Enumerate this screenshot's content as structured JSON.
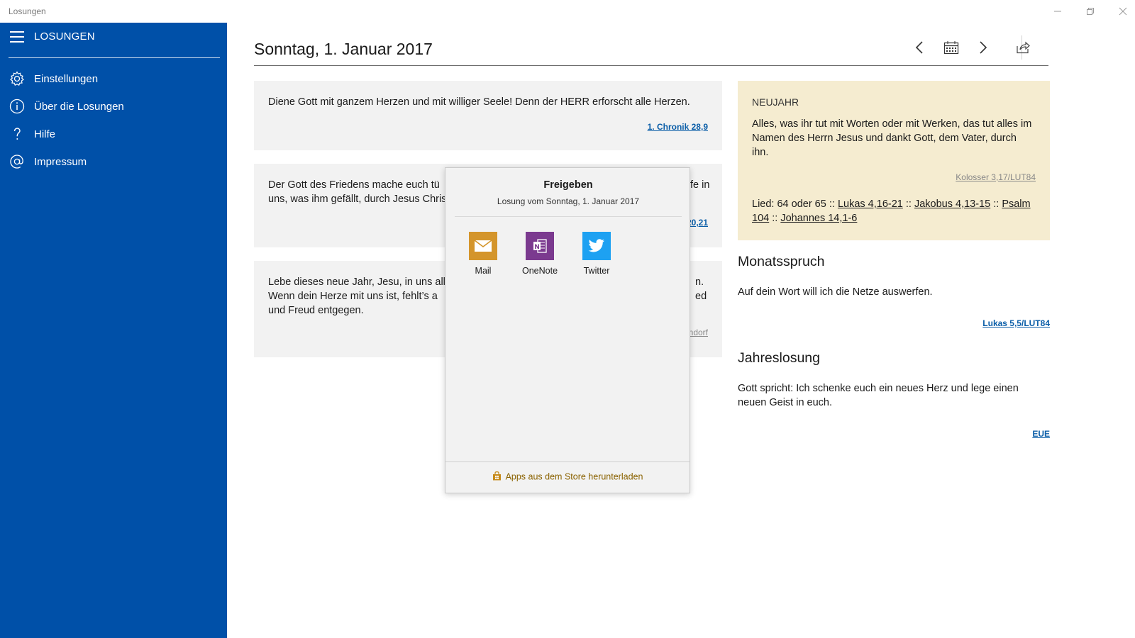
{
  "window": {
    "title": "Losungen"
  },
  "sidebar": {
    "title": "LOSUNGEN",
    "items": [
      {
        "label": "Einstellungen",
        "icon": "gear-icon"
      },
      {
        "label": "Über die Losungen",
        "icon": "info-icon"
      },
      {
        "label": "Hilfe",
        "icon": "help-icon"
      },
      {
        "label": "Impressum",
        "icon": "at-icon"
      }
    ]
  },
  "header": {
    "date": "Sonntag, 1. Januar 2017"
  },
  "cards": [
    {
      "text": "Diene Gott mit ganzem Herzen und mit williger Seele! Denn der HERR erforscht alle Herzen.",
      "ref": "1. Chronik 28,9"
    },
    {
      "text_left": "Der Gott des Friedens mache euch tü",
      "text_right": "fe in",
      "text2_left": "uns, was ihm gefällt, durch Jesus Chris",
      "ref": "20,21"
    },
    {
      "line1_left": "Lebe dieses neue Jahr, Jesu, in uns all",
      "line1_right": "n.",
      "line2_left": "Wenn dein Herze mit uns ist, fehlt’s a",
      "line2_right": "ed",
      "line3": "und Freud entgegen.",
      "ref": "ndorf"
    }
  ],
  "panel": {
    "heading": "NEUJAHR",
    "text": "Alles, was ihr tut mit Worten oder mit Werken, das tut alles im Namen des Herrn Jesus und dankt Gott, dem Vater, durch ihn.",
    "ref": "Kolosser 3,17/LUT84",
    "lied_prefix": "Lied: 64 oder 65 ::",
    "links": [
      "Lukas 4,16-21",
      "Jakobus 4,13-15",
      "Psalm 104",
      "Johannes 14,1-6"
    ],
    "separator": "::"
  },
  "monatsspruch": {
    "title": "Monatsspruch",
    "text": "Auf dein Wort will ich die Netze auswerfen.",
    "ref": "Lukas 5,5/LUT84"
  },
  "jahreslosung": {
    "title": "Jahreslosung",
    "text": "Gott spricht: Ich schenke euch ein neues Herz und lege einen neuen Geist in euch.",
    "ref": "EUE"
  },
  "share": {
    "title": "Freigeben",
    "subtitle": "Losung vom Sonntag, 1. Januar 2017",
    "apps": [
      {
        "label": "Mail",
        "color": "#d4952b"
      },
      {
        "label": "OneNote",
        "color": "#7b3a8f"
      },
      {
        "label": "Twitter",
        "color": "#1da1f2"
      }
    ],
    "footer": "Apps aus dem Store herunterladen"
  },
  "colors": {
    "accent": "#0050a8",
    "link": "#0b5ea8",
    "panel": "#f5ecd0"
  }
}
